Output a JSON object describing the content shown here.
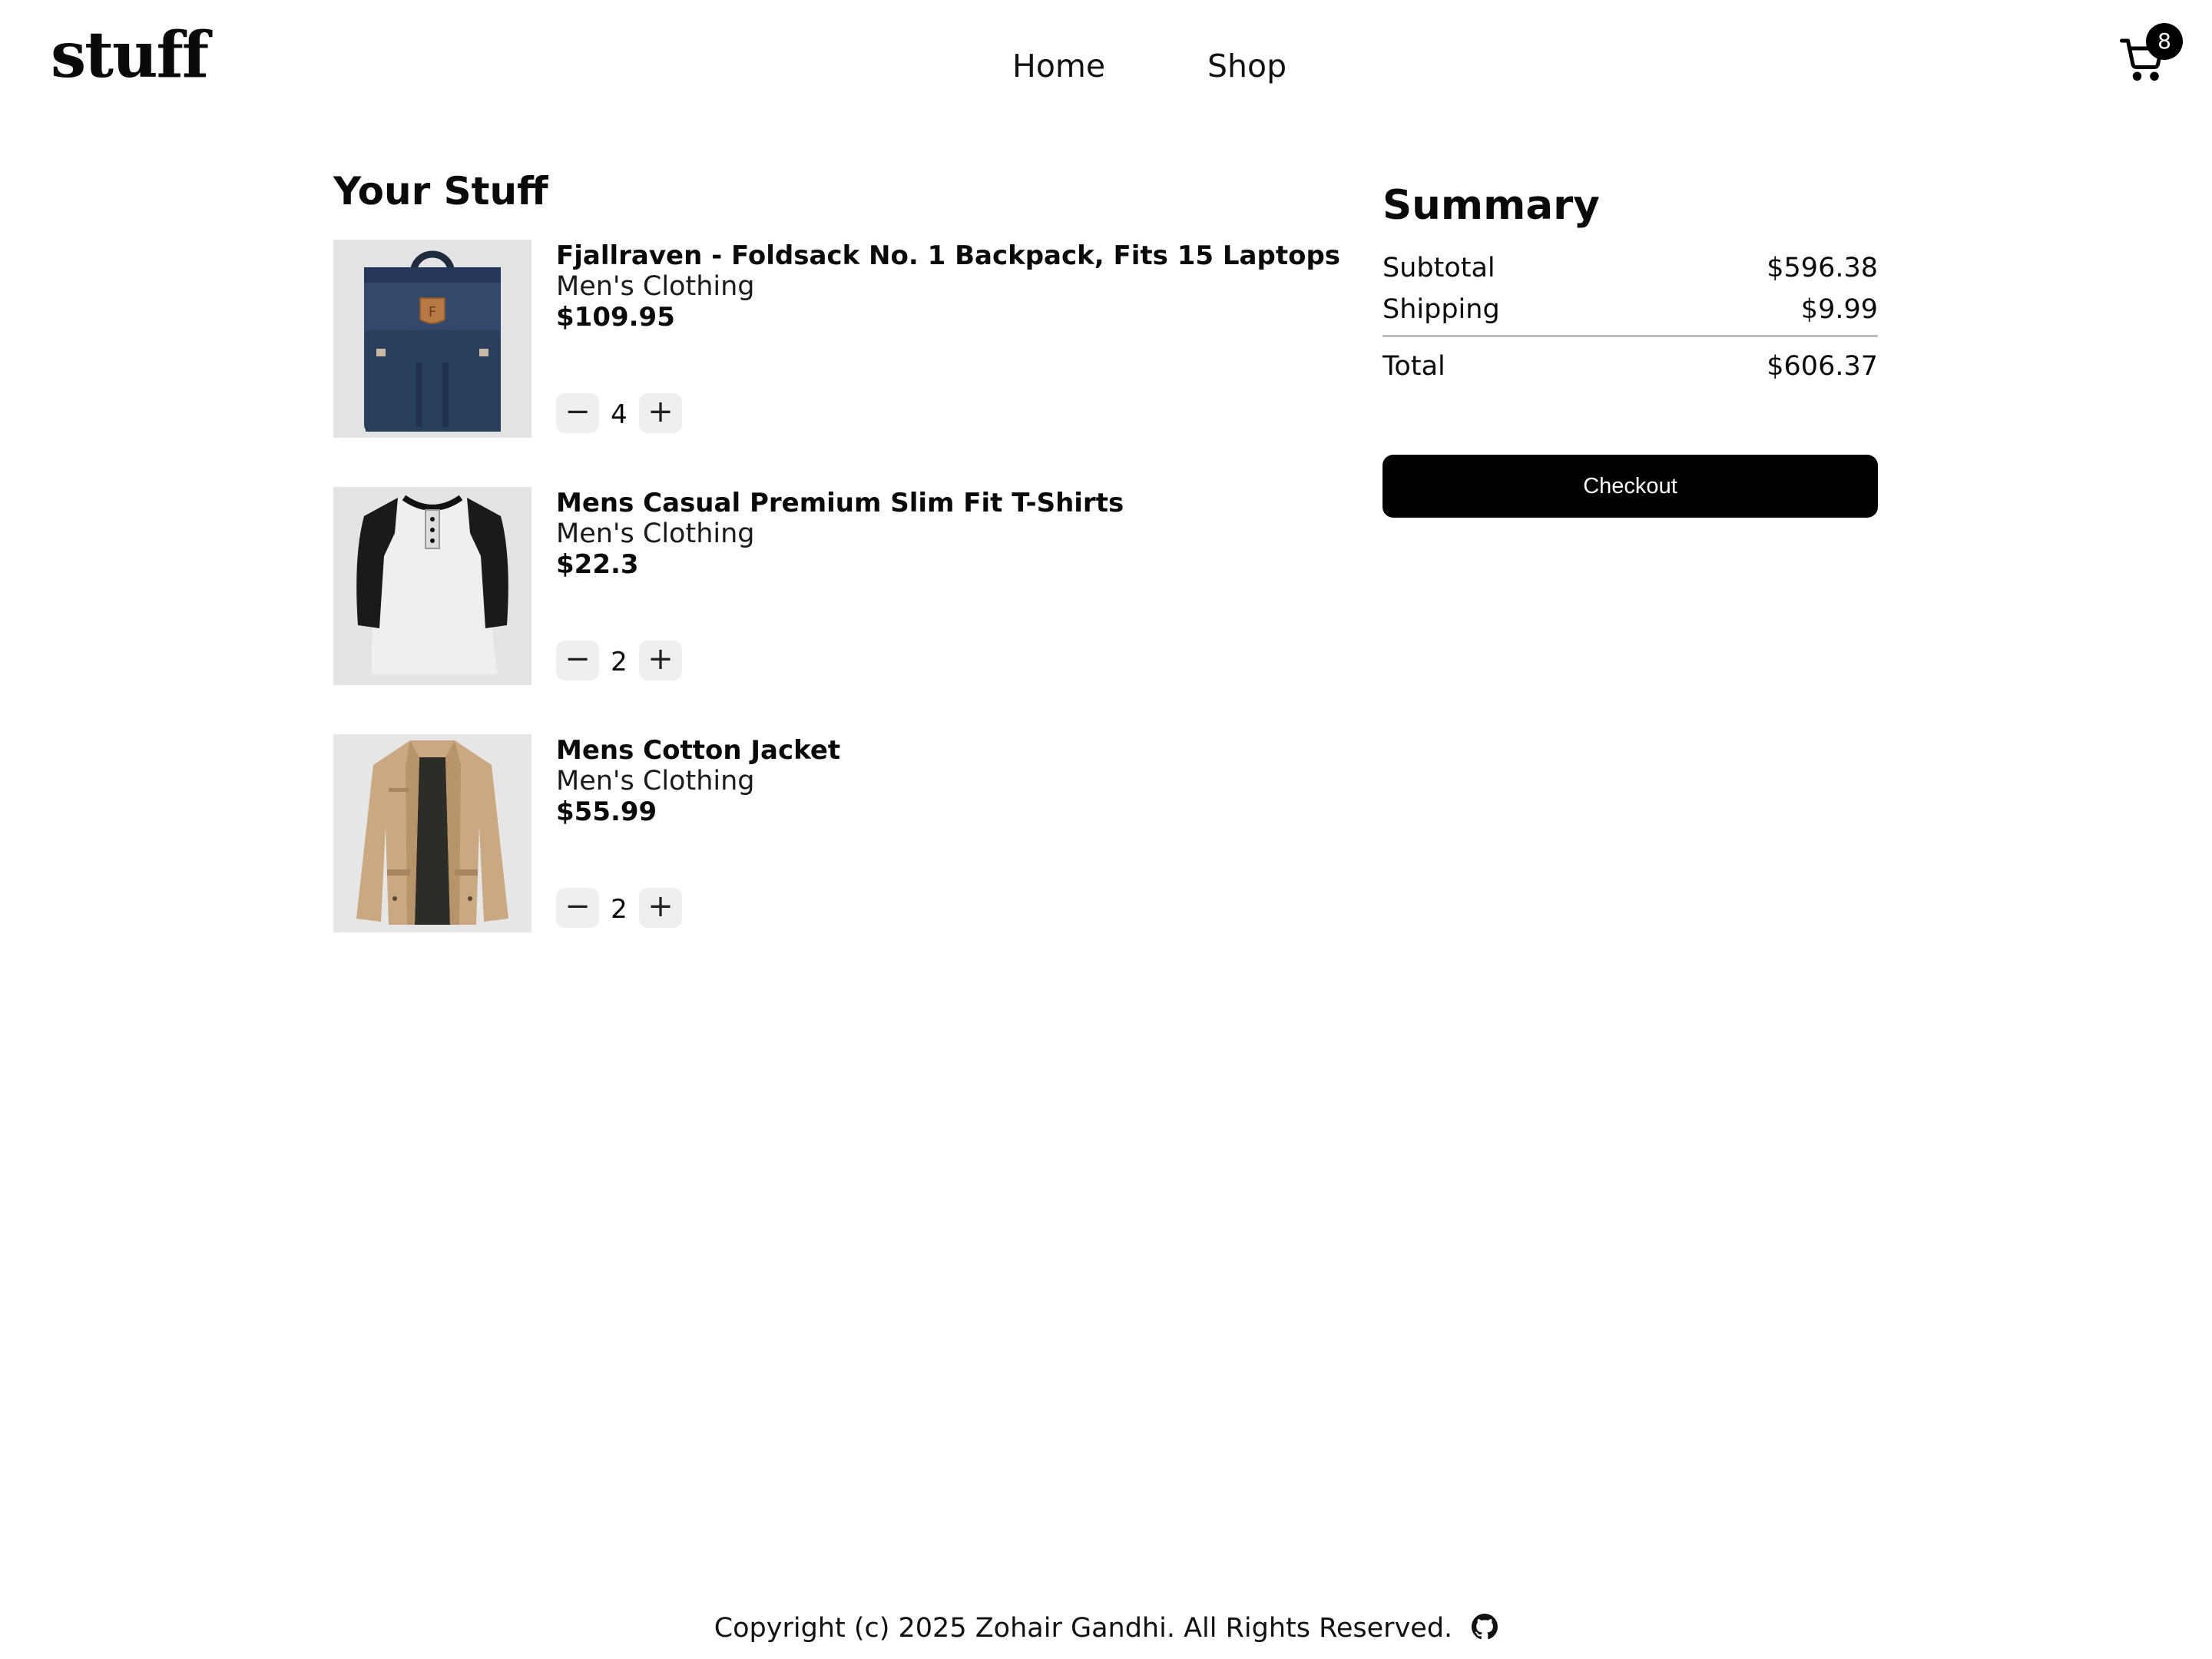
{
  "header": {
    "logo": "stuff",
    "nav": [
      "Home",
      "Shop"
    ],
    "cart_count": "8",
    "cart_icon": "shopping-cart-icon"
  },
  "cart": {
    "heading": "Your Stuff",
    "items": [
      {
        "title": "Fjallraven - Foldsack No. 1 Backpack, Fits 15 Laptops",
        "category": "Men's Clothing",
        "price": "$109.95",
        "quantity": "4",
        "image": "backpack"
      },
      {
        "title": "Mens Casual Premium Slim Fit T-Shirts",
        "category": "Men's Clothing",
        "price": "$22.3",
        "quantity": "2",
        "image": "raglan-shirt"
      },
      {
        "title": "Mens Cotton Jacket",
        "category": "Men's Clothing",
        "price": "$55.99",
        "quantity": "2",
        "image": "jacket"
      }
    ],
    "minus_symbol": "−",
    "plus_symbol": "+"
  },
  "summary": {
    "title": "Summary",
    "subtotal_label": "Subtotal",
    "subtotal_value": "$596.38",
    "shipping_label": "Shipping",
    "shipping_value": "$9.99",
    "total_label": "Total",
    "total_value": "$606.37",
    "checkout_label": "Checkout"
  },
  "footer": {
    "copyright": "Copyright (c) 2025 Zohair Gandhi. All Rights Reserved.",
    "icon": "github-icon"
  },
  "colors": {
    "text": "#0a0a0a",
    "button": "#000000",
    "qty_button_bg": "#efefef",
    "divider": "#bdbdbd"
  }
}
